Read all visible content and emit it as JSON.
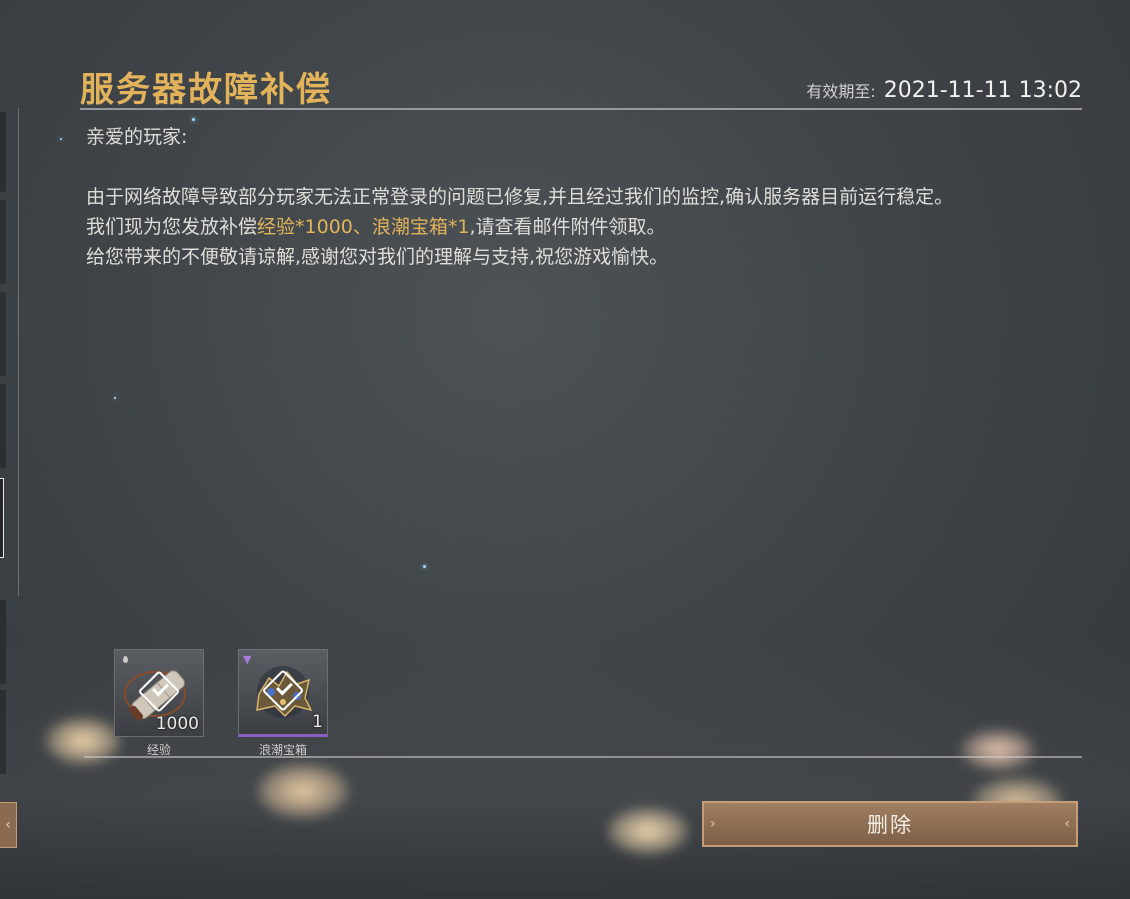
{
  "mail": {
    "title": "服务器故障补偿",
    "expire_label": "有效期至:",
    "expire_value": "2021-11-11 13:02",
    "greeting": "亲爱的玩家:",
    "paragraph1": "由于网络故障导致部分玩家无法正常登录的问题已修复,并且经过我们的监控,确认服务器目前运行稳定。",
    "paragraph2_prefix": "我们现为您发放补偿",
    "paragraph2_highlight": "经验*1000、浪潮宝箱*1",
    "paragraph2_suffix": ",请查看邮件附件领取。",
    "paragraph3": "给您带来的不便敬请谅解,感谢您对我们的理解与支持,祝您游戏愉快。"
  },
  "attachments": [
    {
      "name": "经验",
      "count": "1000",
      "icon": "scroll-icon",
      "rarity_color": "#6b6f74"
    },
    {
      "name": "浪潮宝箱",
      "count": "1",
      "icon": "treasure-chest-icon",
      "rarity_color": "#8a5fc4"
    }
  ],
  "actions": {
    "delete_label": "删除"
  },
  "colors": {
    "title": "#e2b35a",
    "highlight": "#e0b25a",
    "button": "#8a6b52"
  }
}
